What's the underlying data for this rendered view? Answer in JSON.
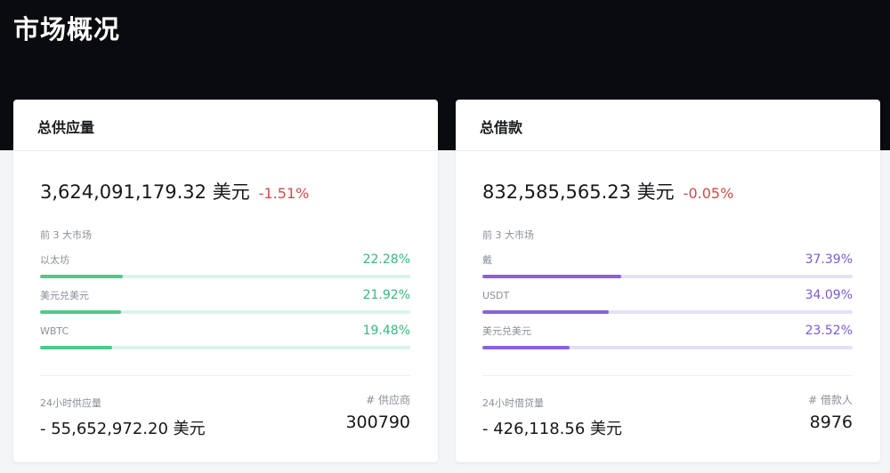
{
  "page": {
    "title": "市场概况"
  },
  "colors": {
    "header_bg": "#0a0b0e",
    "negative": "#cc4b4b",
    "supply_accent": "#4fc98c",
    "borrow_accent": "#8a62d8"
  },
  "supply_card": {
    "title": "总供应量",
    "total_value": "3,624,091,179.32 美元",
    "change": "-1.51%",
    "top_markets_label": "前 3 大市场",
    "markets": [
      {
        "name": "以太坊",
        "percent_text": "22.28%",
        "share": 22.28
      },
      {
        "name": "美元兑美元",
        "percent_text": "21.92%",
        "share": 21.92
      },
      {
        "name": "WBTC",
        "percent_text": "19.48%",
        "share": 19.48
      }
    ],
    "volume_label": "24小时供应量",
    "volume_value": "- 55,652,972.20 美元",
    "count_label": "# 供应商",
    "count_value": "300790"
  },
  "borrow_card": {
    "title": "总借款",
    "total_value": "832,585,565.23 美元",
    "change": "-0.05%",
    "top_markets_label": "前 3 大市场",
    "markets": [
      {
        "name": "戴",
        "percent_text": "37.39%",
        "share": 37.39
      },
      {
        "name": "USDT",
        "percent_text": "34.09%",
        "share": 34.09
      },
      {
        "name": "美元兑美元",
        "percent_text": "23.52%",
        "share": 23.52
      }
    ],
    "volume_label": "24小时借贷量",
    "volume_value": "- 426,118.56 美元",
    "count_label": "# 借款人",
    "count_value": "8976"
  }
}
